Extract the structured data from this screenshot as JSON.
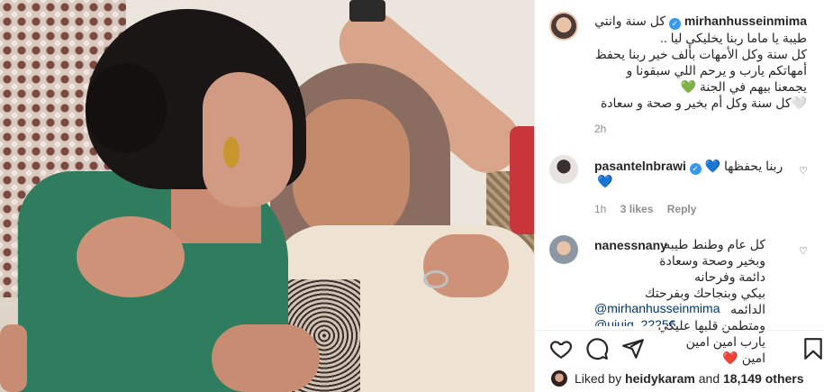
{
  "post": {
    "author": "mirhanhusseinmima",
    "caption": "كل سنة وانتي طيبة يا ماما ربنا يخليكي ليا ..\nكل سنة وكل الأمهات بألف خير ربنا يحفظ أمهاتكم يارب و يرحم اللي سبقونا و يجمعنا بيهم في الجنة 💚\n🤍كل سنة وكل أم بخير و صحة و سعادة",
    "time": "2h"
  },
  "comments": [
    {
      "user": "pasantelnbrawi",
      "text": "ربنا يحفظها 💙",
      "extra": "💙",
      "time": "1h",
      "likes": "3 likes",
      "reply": "Reply"
    },
    {
      "user": "nanessnany",
      "text": "كل عام وطنط طيبه\nوبخير وصحة وسعادة دائمة وفرحانه\nبيكي وبنجاحك وبفرحتك الدائمه\nومتطمن قلبها عليكي يارب امين امين\nامين ❤️",
      "mention": "@mirhanhusseinmima",
      "mention2": "@uiuig_22256"
    }
  ],
  "likes": {
    "prefix": "Liked by",
    "user": "heidykaram",
    "and": "and",
    "count": "18,149 others"
  },
  "icons": [
    "heart-icon",
    "comment-icon",
    "share-icon",
    "bookmark-icon"
  ]
}
